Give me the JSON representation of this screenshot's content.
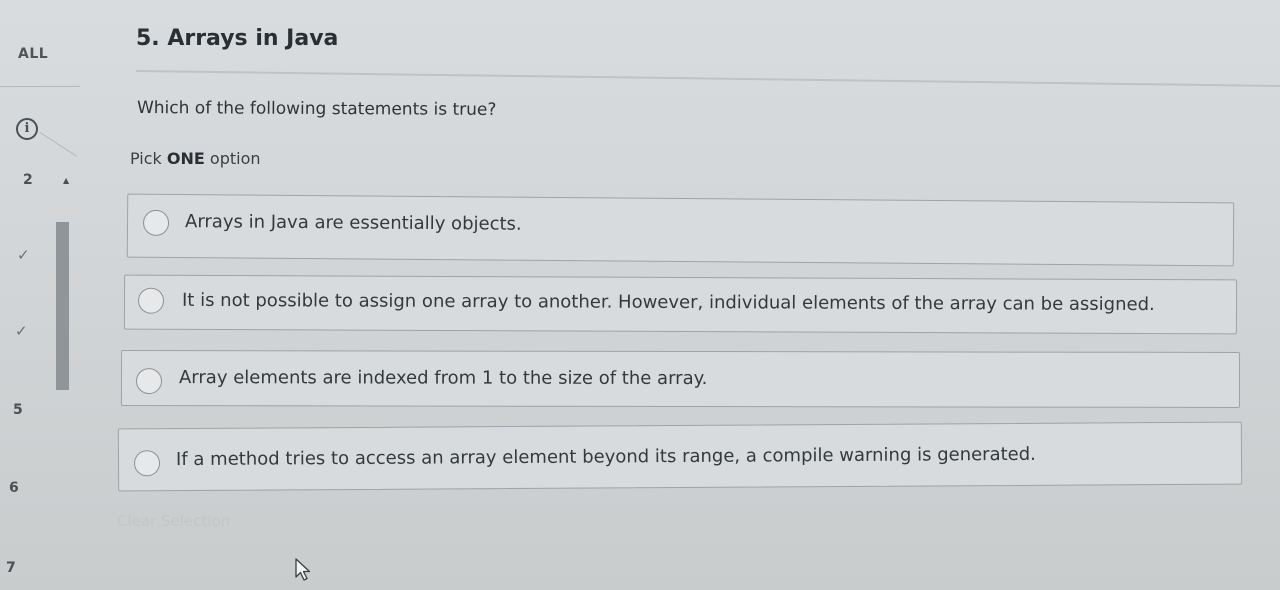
{
  "sidebar": {
    "all_label": "ALL",
    "info_glyph": "i",
    "items": [
      {
        "label": "2",
        "status": "current"
      },
      {
        "label": "",
        "status": "answered"
      },
      {
        "label": "",
        "status": "answered"
      },
      {
        "label": "5",
        "status": "unanswered"
      },
      {
        "label": "6",
        "status": "unanswered"
      },
      {
        "label": "7",
        "status": "unanswered"
      }
    ],
    "check_glyph": "✓",
    "collapse_glyph": "▲"
  },
  "question": {
    "title": "5. Arrays in Java",
    "prompt": "Which of the following statements is true?",
    "instruction_prefix": "Pick ",
    "instruction_bold": "ONE",
    "instruction_suffix": " option",
    "options": [
      {
        "text": "Arrays in Java are essentially objects.",
        "selected": false
      },
      {
        "text": "It is not possible to assign one array to another. However, individual elements of the array can be assigned.",
        "selected": false
      },
      {
        "text": "Array elements are indexed from 1 to the size of the array.",
        "selected": false
      },
      {
        "text": "If a method tries to access an array element beyond its range, a compile warning is generated.",
        "selected": false
      }
    ],
    "clear_label": "Clear Selection"
  },
  "colors": {
    "background": "#d3d6d8",
    "option_border": "#9ea3a6",
    "text": "#2f3437",
    "clear_disabled": "#c2c6c9"
  }
}
